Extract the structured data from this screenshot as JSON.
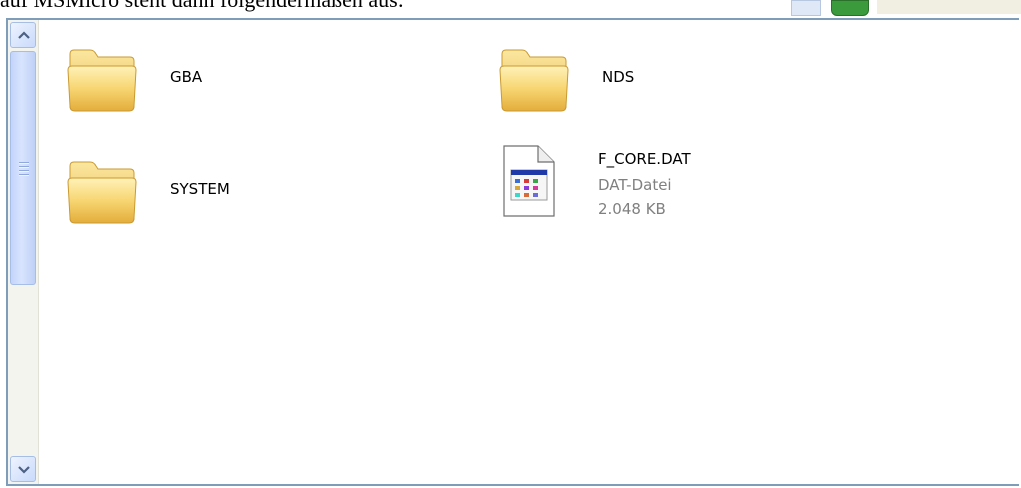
{
  "document": {
    "partial_text_line": "auf MSMicro steht dann folgendermaßen aus:"
  },
  "scrollbar": {
    "up_icon": "scroll-up-arrow-icon",
    "down_icon": "scroll-down-arrow-icon"
  },
  "folders": [
    {
      "name": "GBA",
      "icon": "folder-icon"
    },
    {
      "name": "NDS",
      "icon": "folder-icon"
    },
    {
      "name": "SYSTEM",
      "icon": "folder-icon"
    }
  ],
  "files": [
    {
      "name": "F_CORE.DAT",
      "type": "DAT-Datei",
      "size": "2.048 KB",
      "icon": "dat-file-icon"
    }
  ],
  "colors": {
    "window_border": "#7f9db9",
    "folder_yellow": "#f5d36b",
    "scrollbar_blue": "#c3d4fb",
    "secondary_text": "#808080"
  }
}
